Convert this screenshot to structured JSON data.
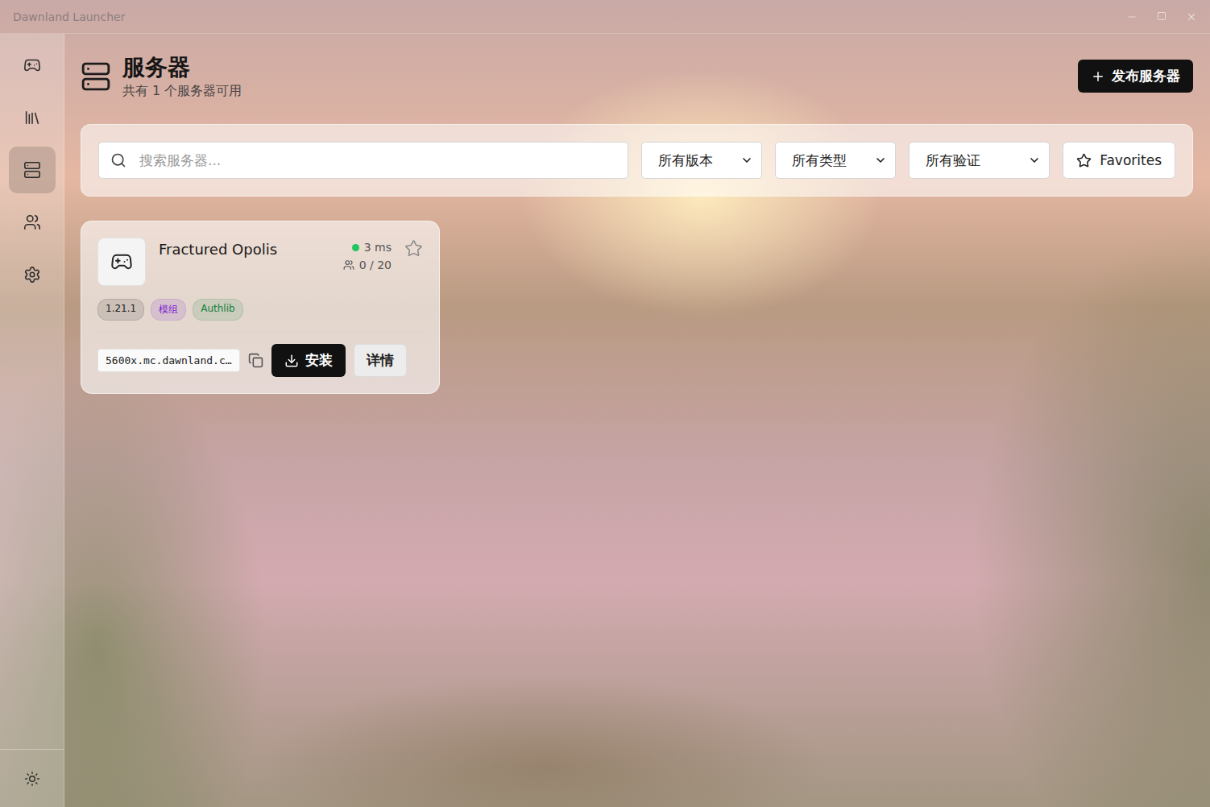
{
  "window": {
    "title": "Dawnland Launcher"
  },
  "sidebar": {
    "items": [
      {
        "selected": false
      },
      {
        "selected": false
      },
      {
        "selected": true
      },
      {
        "selected": false
      },
      {
        "selected": false
      }
    ],
    "theme_toggle": {
      "selected": false
    }
  },
  "header": {
    "title": "服务器",
    "subtitle": "共有 1 个服务器可用",
    "publish_button": "发布服务器"
  },
  "filters": {
    "search_placeholder": "搜索服务器...",
    "selects": [
      "所有版本",
      "所有类型",
      "所有验证"
    ],
    "favorites": {
      "label": "Favorites",
      "selected": false
    }
  },
  "servers": [
    {
      "name": "Fractured Opolis",
      "ping": "3 ms",
      "online": true,
      "players": "0 / 20",
      "favorite": false,
      "tags": [
        {
          "label": "1.21.1",
          "color": "#222222"
        },
        {
          "label": "模组",
          "color": "#7e22ce"
        },
        {
          "label": "Authlib",
          "color": "#15803d"
        }
      ],
      "address": "5600x.mc.dawnland.c…",
      "install_button": "安装",
      "details_button": "详情"
    }
  ]
}
